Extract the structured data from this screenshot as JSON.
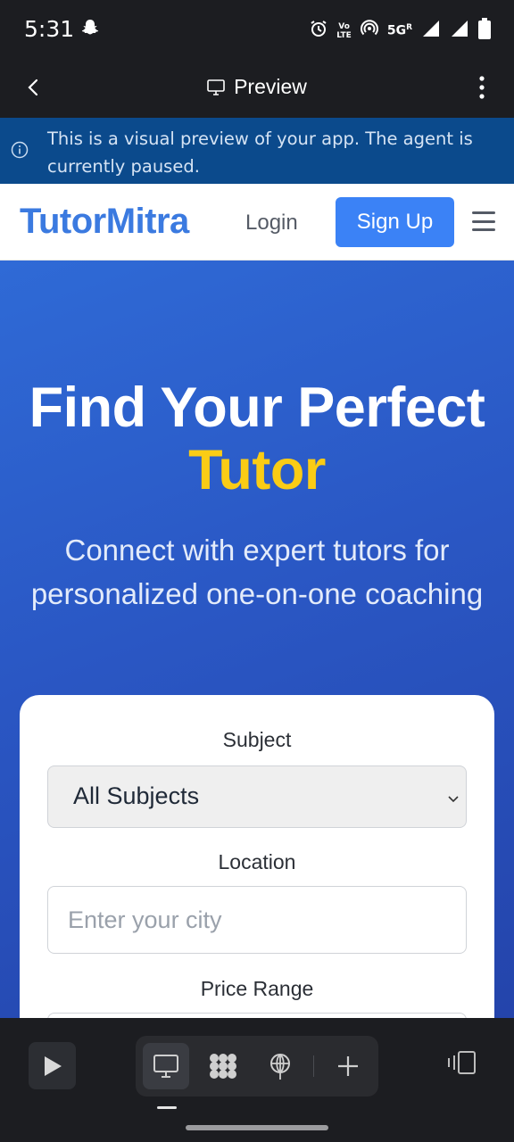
{
  "status_bar": {
    "time": "5:31",
    "network": "5G",
    "network_suffix": "R",
    "volte_line1": "Vo",
    "volte_line2": "LTE"
  },
  "header": {
    "title": "Preview",
    "back_icon": "chevron-left-icon",
    "menu_icon": "more-vertical-icon"
  },
  "banner": {
    "text": "This is a visual preview of your app. The agent is currently paused."
  },
  "app": {
    "brand": "TutorMitra",
    "login_label": "Login",
    "signup_label": "Sign Up",
    "menu_icon": "hamburger-icon",
    "hero": {
      "title_line1": "Find Your Perfect",
      "title_accent": "Tutor",
      "subtitle": "Connect with expert tutors for personalized one-on-one coaching"
    },
    "search": {
      "subject_label": "Subject",
      "subject_value": "All Subjects",
      "location_label": "Location",
      "location_placeholder": "Enter your city",
      "price_label": "Price Range"
    }
  },
  "colors": {
    "brand": "#3b7ae0",
    "signup": "#3b82f6",
    "hero_start": "#2f6ad6",
    "hero_end": "#2444ab",
    "accent": "#facc15",
    "banner": "#0b4a8c"
  },
  "toolbar": {
    "items": [
      "play-icon",
      "desktop-icon",
      "grid-icon",
      "deploy-icon",
      "add-icon",
      "panel-icon"
    ]
  }
}
